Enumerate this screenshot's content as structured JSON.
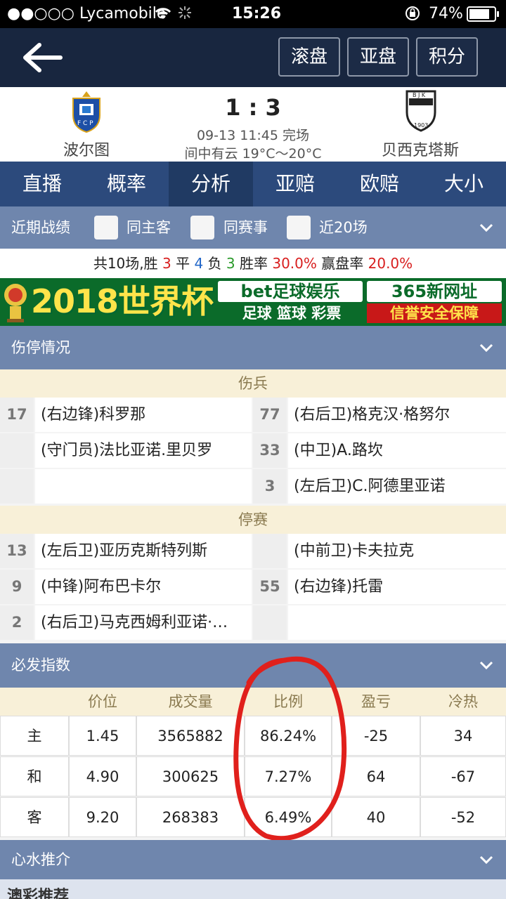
{
  "status": {
    "carrier": "●●○○○ Lycamobile",
    "time": "15:26",
    "battery": "74%"
  },
  "topnav": {
    "btn1": "滚盘",
    "btn2": "亚盘",
    "btn3": "积分"
  },
  "match": {
    "home": "波尔图",
    "away": "贝西克塔斯",
    "score": "1 : 3",
    "datetime": "09-13 11:45 完场",
    "weather": "间中有云 19°C～20°C"
  },
  "tabs": [
    "直播",
    "概率",
    "分析",
    "亚赔",
    "欧赔",
    "大小"
  ],
  "recent": {
    "title": "近期战绩",
    "opt1": "同主客",
    "opt2": "同赛事",
    "opt3": "近20场",
    "p1": "共10场,胜",
    "wins": "3",
    "p2": "平",
    "draws": "4",
    "p3": "负",
    "losses": "3",
    "p4": "胜率",
    "winrate": "30.0%",
    "p5": "赢盘率",
    "coverrate": "20.0%"
  },
  "banner": {
    "big": "2018世界杯",
    "t1": "bet足球娱乐",
    "t2": "365新网址",
    "t3": "足球 篮球 彩票",
    "t4": "信誉安全保障"
  },
  "injury": {
    "title": "伤停情况",
    "injured_label": "伤兵",
    "suspended_label": "停赛",
    "injured": [
      {
        "hn": "17",
        "h": "(右边锋)科罗那",
        "an": "77",
        "a": "(右后卫)格克汉·格努尔"
      },
      {
        "hn": "",
        "h": "(守门员)法比亚诺.里贝罗",
        "an": "33",
        "a": "(中卫)A.路坎"
      },
      {
        "hn": "",
        "h": "",
        "an": "3",
        "a": "(左后卫)C.阿德里亚诺"
      }
    ],
    "suspended": [
      {
        "hn": "13",
        "h": "(左后卫)亚历克斯特列斯",
        "an": "",
        "a": "(中前卫)卡夫拉克"
      },
      {
        "hn": "9",
        "h": "(中锋)阿布巴卡尔",
        "an": "55",
        "a": "(右边锋)托雷"
      },
      {
        "hn": "2",
        "h": "(右后卫)马克西姆利亚诺·…",
        "an": "",
        "a": ""
      }
    ]
  },
  "index": {
    "title": "必发指数",
    "headers": [
      "",
      "价位",
      "成交量",
      "比例",
      "盈亏",
      "冷热"
    ],
    "rows": [
      [
        "主",
        "1.45",
        "3565882",
        "86.24%",
        "-25",
        "34"
      ],
      [
        "和",
        "4.90",
        "300625",
        "7.27%",
        "64",
        "-67"
      ],
      [
        "客",
        "9.20",
        "268383",
        "6.49%",
        "40",
        "-52"
      ]
    ]
  },
  "xinshui": {
    "title": "心水推介"
  },
  "aocai": {
    "title": "澳彩推荐"
  },
  "colors": {
    "nav": "#18263f",
    "tabs": "#2c4a7c",
    "section": "#6f86ad",
    "highlight_circle": "#e0201c"
  }
}
